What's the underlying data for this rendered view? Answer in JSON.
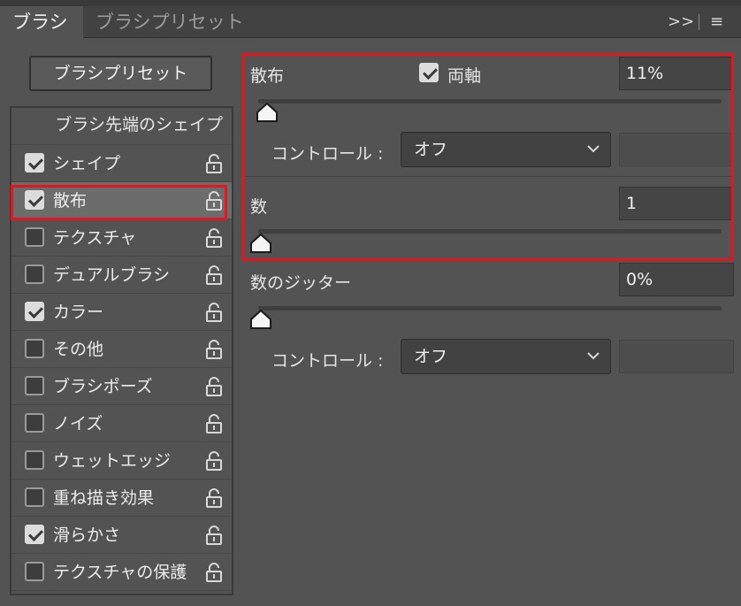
{
  "tabs": {
    "active": "ブラシ",
    "inactive": "ブラシプリセット",
    "expand": ">>",
    "menu": "≡"
  },
  "preset_button": "ブラシプリセット",
  "list": {
    "header": "ブラシ先端のシェイプ",
    "items": [
      {
        "label": "シェイプ",
        "checked": true
      },
      {
        "label": "散布",
        "checked": true,
        "selected": true
      },
      {
        "label": "テクスチャ",
        "checked": false
      },
      {
        "label": "デュアルブラシ",
        "checked": false
      },
      {
        "label": "カラー",
        "checked": true
      },
      {
        "label": "その他",
        "checked": false
      },
      {
        "label": "ブラシポーズ",
        "checked": false
      },
      {
        "label": "ノイズ",
        "checked": false
      },
      {
        "label": "ウェットエッジ",
        "checked": false
      },
      {
        "label": "重ね描き効果",
        "checked": false
      },
      {
        "label": "滑らかさ",
        "checked": true
      },
      {
        "label": "テクスチャの保護",
        "checked": false
      }
    ]
  },
  "scatter": {
    "label": "散布",
    "both_axes_label": "両軸",
    "both_axes_checked": true,
    "value": "11%",
    "slider_value": 0.11
  },
  "control1": {
    "label": "コントロール :",
    "value": "オフ"
  },
  "count": {
    "label": "数",
    "value": "1",
    "slider_value": 0.0
  },
  "count_jitter": {
    "label": "数のジッター",
    "value": "0%",
    "slider_value": 0.0
  },
  "control2": {
    "label": "コントロール :",
    "value": "オフ"
  },
  "colors": {
    "highlight": "#e5141f",
    "panel": "#535353"
  }
}
